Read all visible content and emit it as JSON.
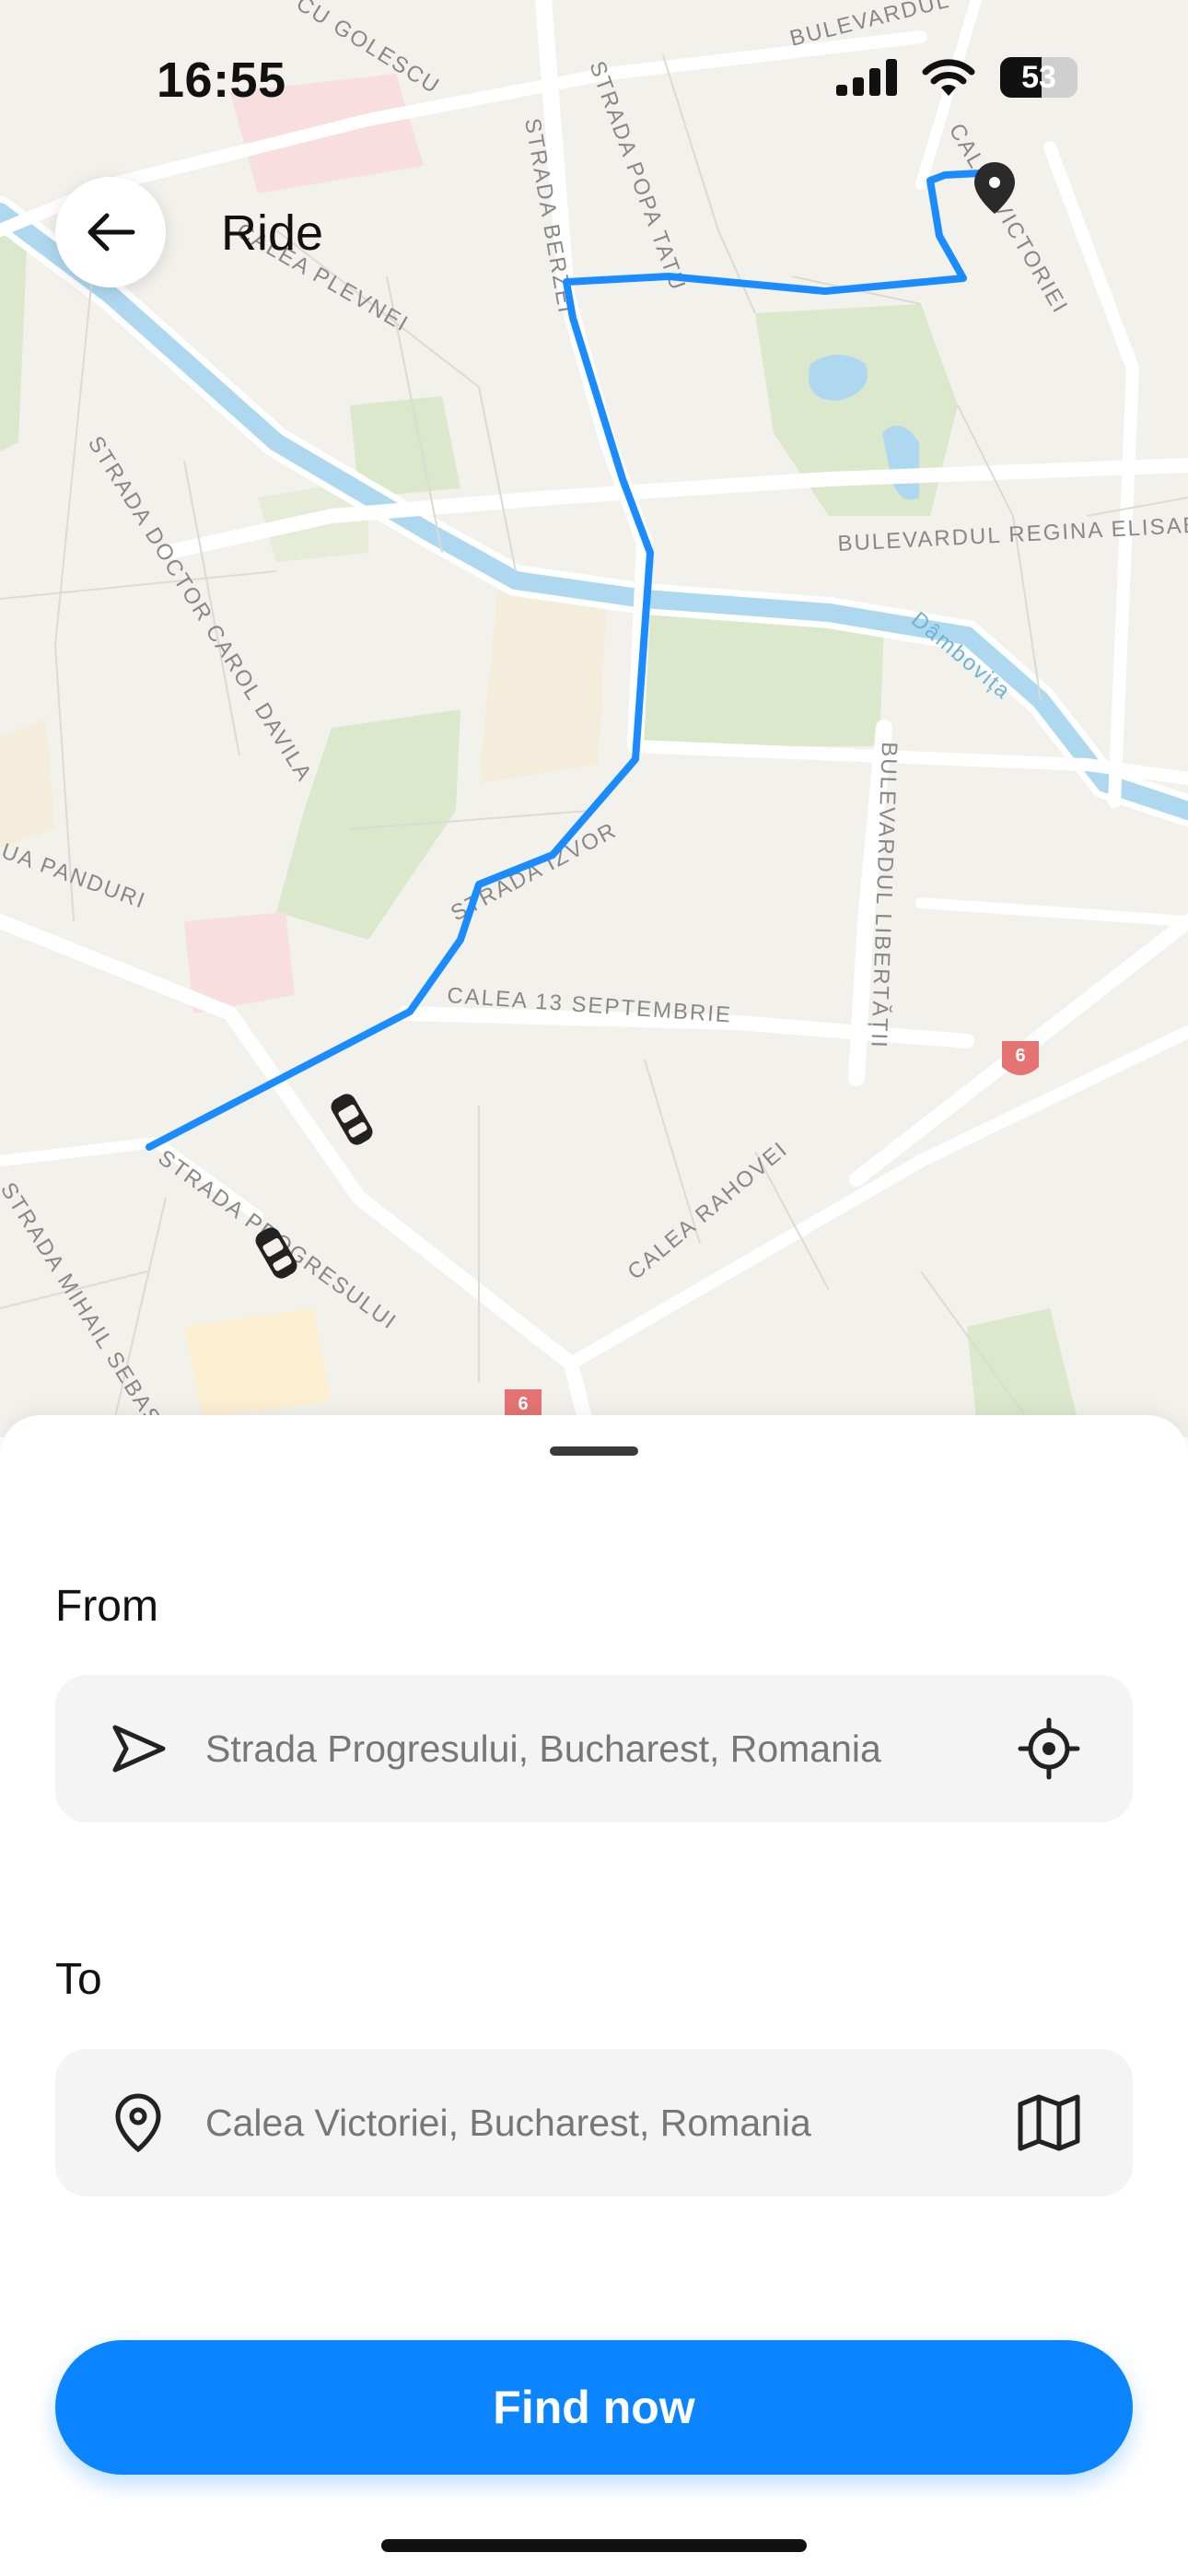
{
  "status_bar": {
    "time": "16:55",
    "battery_level": "53"
  },
  "header": {
    "title": "Ride"
  },
  "map": {
    "street_labels": [
      "BULEVARDUL",
      "STRADA POPA TATU",
      "STRADA BERZEI",
      "CALEA VICTORIEI",
      "CALEA PLEVNEI",
      "BULEVARDUL REGINA ELISABETA",
      "Dâmbovița",
      "STRADA DOCTOR CAROL DAVILA",
      "BULEVARDUL LIBERTĂȚII",
      "STRADA IZVOR",
      "CALEA 13 SEPTEMBRIE",
      "CALEA RAHOVEI",
      "STRADA PROGRESULUI",
      "STRADA MIHAIL SEBASTIAN",
      "CU GOLESCU",
      "UA PANDURI"
    ],
    "road_shield": "6",
    "colors": {
      "route": "#1a8cff",
      "river": "#aed8f0",
      "park": "#dbe8cc",
      "land": "#f3f1ec"
    }
  },
  "sheet": {
    "from_label": "From",
    "from_value": "Strada Progresului, Bucharest, Romania",
    "to_label": "To",
    "to_value": "Calea Victoriei, Bucharest, Romania",
    "cta_label": "Find now"
  },
  "colors": {
    "accent": "#0a84ff",
    "field_bg": "#f4f4f4"
  },
  "icons": {
    "back": "arrow-left-icon",
    "from": "navigation-arrow-icon",
    "locate": "crosshair-icon",
    "to": "location-pin-icon",
    "map": "map-icon"
  }
}
